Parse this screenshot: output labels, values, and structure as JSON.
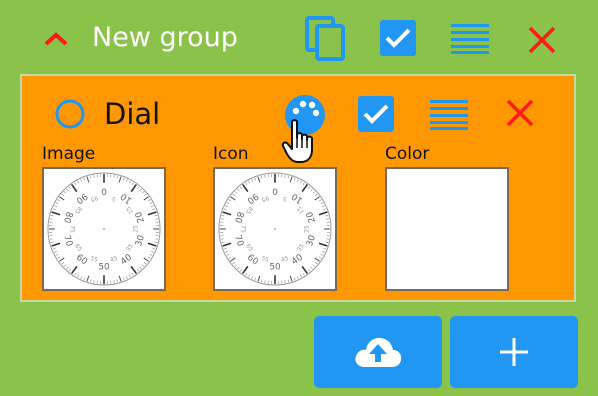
{
  "group": {
    "title": "New group"
  },
  "item": {
    "title": "Dial",
    "fields": {
      "image_label": "Image",
      "icon_label": "Icon",
      "color_label": "Color"
    },
    "color_value": "#ffffff"
  },
  "dial": {
    "major_ticks": [
      "0",
      "10",
      "20",
      "30",
      "40",
      "50",
      "60",
      "70",
      "80",
      "90"
    ],
    "minor_labels": [
      "5",
      "15",
      "25",
      "35",
      "45",
      "55",
      "65",
      "75",
      "85",
      "95"
    ]
  },
  "colors": {
    "background": "#8bc34a",
    "panel": "#ff9800",
    "accent_blue": "#2196f3",
    "close_red": "#ff1a1a"
  },
  "icons": {
    "group_collapse": "chevron-up-icon",
    "group_copy": "copy-icon",
    "group_check": "checkbox-icon",
    "group_menu": "lines-icon",
    "group_close": "close-icon",
    "item_select": "radio-circle-icon",
    "item_palette": "palette-icon",
    "item_check": "checkbox-icon",
    "item_menu": "lines-icon",
    "item_close": "close-icon",
    "upload": "cloud-upload-icon",
    "add": "plus-icon",
    "cursor": "hand-pointer-icon"
  }
}
